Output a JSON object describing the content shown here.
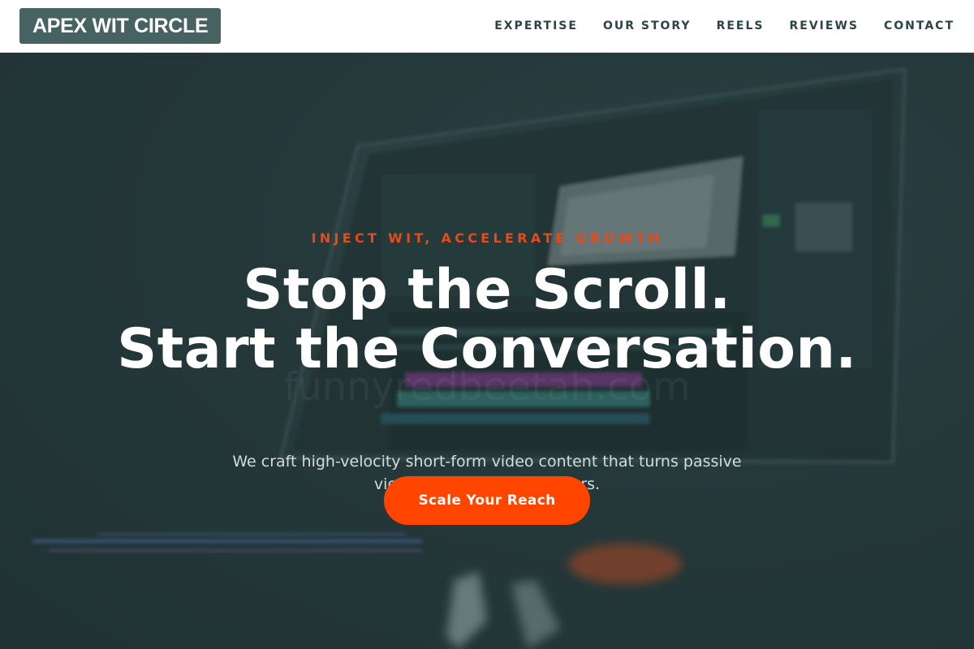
{
  "header": {
    "logo": "APEX WIT CIRCLE",
    "nav": [
      {
        "label": "EXPERTISE"
      },
      {
        "label": "OUR STORY"
      },
      {
        "label": "REELS"
      },
      {
        "label": "REVIEWS"
      },
      {
        "label": "CONTACT"
      }
    ]
  },
  "hero": {
    "eyebrow": "INJECT WIT, ACCELERATE GROWTH",
    "headline_line1": "Stop the Scroll.",
    "headline_line2": "Start the Conversation.",
    "subtext": "We craft high-velocity short-form video content that turns passive viewers into loyal customers.",
    "cta_label": "Scale Your Reach",
    "background_watermark": "funnyredbeetah.com",
    "background_description_icon": "video-editing-laptop-image"
  },
  "colors": {
    "brand_dark": "#466362",
    "accent": "#ff4500",
    "hero_bg": "#263a3c",
    "nav_text": "#2c4446"
  }
}
